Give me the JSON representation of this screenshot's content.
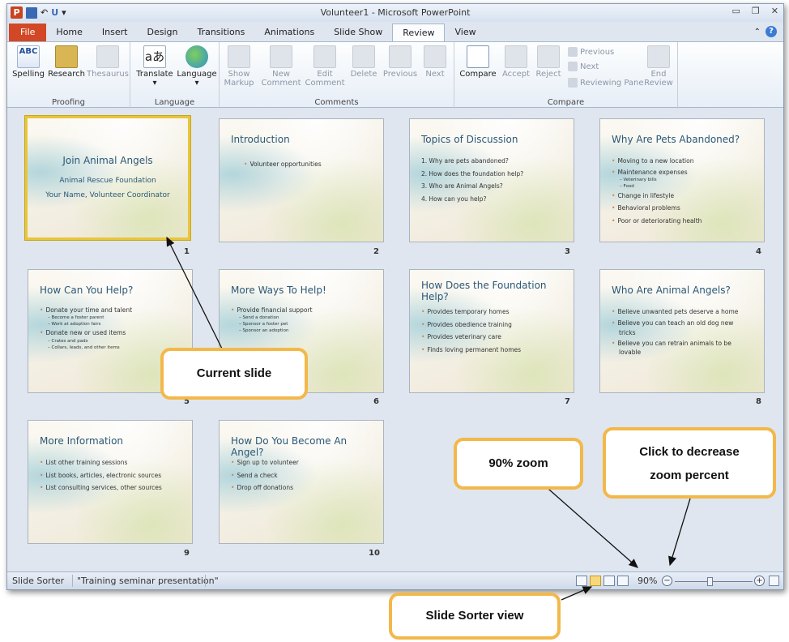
{
  "window": {
    "title": "Volunteer1 - Microsoft PowerPoint",
    "app_icon": "P",
    "qat_icons": [
      "save-icon",
      "undo-icon",
      "redo-icon",
      "customize-icon"
    ]
  },
  "tabs": [
    "File",
    "Home",
    "Insert",
    "Design",
    "Transitions",
    "Animations",
    "Slide Show",
    "Review",
    "View"
  ],
  "active_tab": "Review",
  "ribbon": {
    "proofing": {
      "label": "Proofing",
      "spelling": "Spelling",
      "research": "Research",
      "thesaurus": "Thesaurus",
      "spelling_icon_text": "ABC"
    },
    "language": {
      "label": "Language",
      "translate": "Translate",
      "language_btn": "Language",
      "translate_icon_text": "aあ"
    },
    "comments": {
      "label": "Comments",
      "show_markup_1": "Show",
      "show_markup_2": "Markup",
      "new_comment_1": "New",
      "new_comment_2": "Comment",
      "edit_comment_1": "Edit",
      "edit_comment_2": "Comment",
      "delete": "Delete",
      "previous": "Previous",
      "next": "Next"
    },
    "compare": {
      "label": "Compare",
      "compare": "Compare",
      "accept": "Accept",
      "reject": "Reject",
      "previous": "Previous",
      "next": "Next",
      "reviewing_pane": "Reviewing Pane",
      "end_review_1": "End",
      "end_review_2": "Review"
    }
  },
  "slides": [
    {
      "num": "1",
      "title": "Join Animal Angels",
      "subtitle1": "Animal Rescue Foundation",
      "subtitle2": "Your Name, Volunteer Coordinator"
    },
    {
      "num": "2",
      "title": "Introduction",
      "bullets": [
        "Volunteer opportunities"
      ]
    },
    {
      "num": "3",
      "title": "Topics of Discussion",
      "bullets": [
        "1. Why are pets abandoned?",
        "2. How does the foundation help?",
        "3. Who are Animal Angels?",
        "4. How can you help?"
      ]
    },
    {
      "num": "4",
      "title": "Why Are Pets Abandoned?",
      "bullets": [
        "Moving to a new location",
        "Maintenance expenses",
        "– Veterinary bills",
        "– Food",
        "Change in lifestyle",
        "Behavioral problems",
        "Poor or deteriorating health"
      ]
    },
    {
      "num": "5",
      "title": "How Can You Help?",
      "bullets": [
        "Donate your time and talent",
        "– Become a foster parent",
        "– Work at adoption fairs",
        "Donate new or used items",
        "– Crates and pads",
        "– Collars, leads, and other items"
      ]
    },
    {
      "num": "6",
      "title": "More Ways To Help!",
      "bullets": [
        "Provide financial support",
        "– Send a donation",
        "– Sponsor a foster pet",
        "– Sponsor an adoption"
      ]
    },
    {
      "num": "7",
      "title": "How Does the Foundation Help?",
      "bullets": [
        "Provides temporary homes",
        "Provides obedience training",
        "Provides veterinary care",
        "Finds loving permanent homes"
      ]
    },
    {
      "num": "8",
      "title": "Who Are Animal Angels?",
      "bullets": [
        "Believe unwanted pets deserve a home",
        "Believe you can teach an old dog new",
        "tricks",
        "Believe you can retrain animals to be",
        "lovable"
      ]
    },
    {
      "num": "9",
      "title": "More Information",
      "bullets": [
        "List other training sessions",
        "List books, articles, electronic sources",
        "List consulting services, other sources"
      ]
    },
    {
      "num": "10",
      "title": "How Do You Become An Angel?",
      "bullets": [
        "Sign up to volunteer",
        "Send a check",
        "Drop off donations"
      ]
    }
  ],
  "statusbar": {
    "view_name": "Slide Sorter",
    "theme": "\"Training seminar presentation\"",
    "zoom": "90%",
    "zoom_level_percent": 90
  },
  "callouts": {
    "current_slide": "Current slide",
    "zoom_90": "90% zoom",
    "decrease_zoom_1": "Click to decrease",
    "decrease_zoom_2": "zoom percent",
    "slide_sorter_view": "Slide Sorter view"
  },
  "colors": {
    "file_tab": "#d24726",
    "selection": "#e8c53a",
    "callout_border": "#f3b84a",
    "slide_title": "#2b5876",
    "bullet": "#d6804a"
  }
}
